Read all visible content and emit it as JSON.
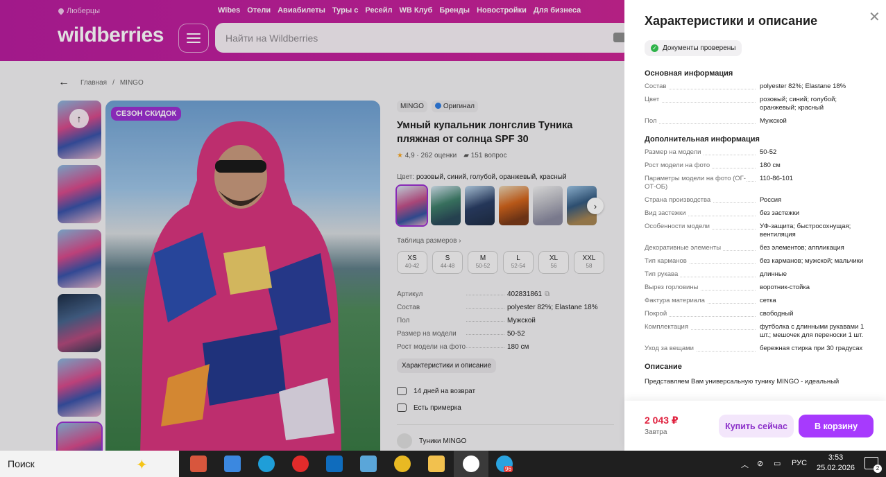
{
  "header": {
    "location": "Люберцы",
    "nav": [
      "Wibes",
      "Отели",
      "Авиабилеты",
      "Туры с",
      "Ресейл",
      "WB Клуб",
      "Бренды",
      "Новостройки",
      "Для бизнеса"
    ],
    "logo": "wildberries",
    "search_placeholder": "Найти на Wildberries"
  },
  "breadcrumb": [
    "Главная",
    "/",
    "MINGO"
  ],
  "product": {
    "badge": "СЕЗОН СКИДОК",
    "brand": "MINGO",
    "original": "Оригинал",
    "title": "Умный купальник лонгслив Туника пляжная от солнца SPF 30",
    "rating": "4,9 · 262 оценки",
    "questions": "151 вопрос",
    "color_label": "Цвет:",
    "color_value": "розовый, синий, голубой, оранжевый, красный",
    "size_table": "Таблица размеров",
    "sizes": [
      {
        "size": "XS",
        "ru": "40-42"
      },
      {
        "size": "S",
        "ru": "44-48"
      },
      {
        "size": "M",
        "ru": "50-52"
      },
      {
        "size": "L",
        "ru": "52-54"
      },
      {
        "size": "XL",
        "ru": "56"
      },
      {
        "size": "XXL",
        "ru": "58"
      }
    ],
    "specs": [
      {
        "k": "Артикул",
        "v": "402831861"
      },
      {
        "k": "Состав",
        "v": "polyester 82%; Elastane 18%"
      },
      {
        "k": "Пол",
        "v": "Мужской"
      },
      {
        "k": "Размер на модели",
        "v": "50-52"
      },
      {
        "k": "Рост модели на фото",
        "v": "180 см"
      }
    ],
    "char_button": "Характеристики и описание",
    "return": "14 дней на возврат",
    "fitting": "Есть примерка",
    "category": "Туники MINGO"
  },
  "panel": {
    "title": "Характеристики и описание",
    "docs": "Документы проверены",
    "main_title": "Основная информация",
    "main": [
      {
        "k": "Состав",
        "v": "polyester 82%; Elastane 18%"
      },
      {
        "k": "Цвет",
        "v": "розовый; синий; голубой; оранжевый; красный"
      },
      {
        "k": "Пол",
        "v": "Мужской"
      }
    ],
    "extra_title": "Дополнительная информация",
    "extra": [
      {
        "k": "Размер на модели",
        "v": "50-52"
      },
      {
        "k": "Рост модели на фото",
        "v": "180 см"
      },
      {
        "k": "Параметры модели на фото (ОГ-ОТ-ОБ)",
        "v": "110-86-101"
      },
      {
        "k": "Страна производства",
        "v": "Россия"
      },
      {
        "k": "Вид застежки",
        "v": "без застежки"
      },
      {
        "k": "Особенности модели",
        "v": "УФ-защита; быстросохнущая; вентиляция"
      },
      {
        "k": "Декоративные элементы",
        "v": "без элементов; аппликация"
      },
      {
        "k": "Тип карманов",
        "v": "без карманов; мужской; мальчики"
      },
      {
        "k": "Тип рукава",
        "v": "длинные"
      },
      {
        "k": "Вырез горловины",
        "v": "воротник-стойка"
      },
      {
        "k": "Фактура материала",
        "v": "сетка"
      },
      {
        "k": "Покрой",
        "v": "свободный"
      },
      {
        "k": "Комплектация",
        "v": "футболка с длинными рукавами 1 шт.; мешочек для переноски 1 шт."
      },
      {
        "k": "Уход за вещами",
        "v": "бережная стирка при 30 градусах"
      }
    ],
    "desc_title": "Описание",
    "desc_text": "Представляем Вам универсальную тунику MINGO - идеальный",
    "price": "2 043 ₽",
    "delivery": "Завтра",
    "buy_now": "Купить сейчас",
    "to_cart": "В корзину"
  },
  "taskbar": {
    "search": "Поиск",
    "lang": "РУС",
    "time": "3:53",
    "date": "25.02.2026",
    "notifications": "2",
    "badge": "96"
  },
  "colors": {
    "accent": "#a73afd",
    "header": "#c3219b",
    "price": "#e0223f"
  }
}
